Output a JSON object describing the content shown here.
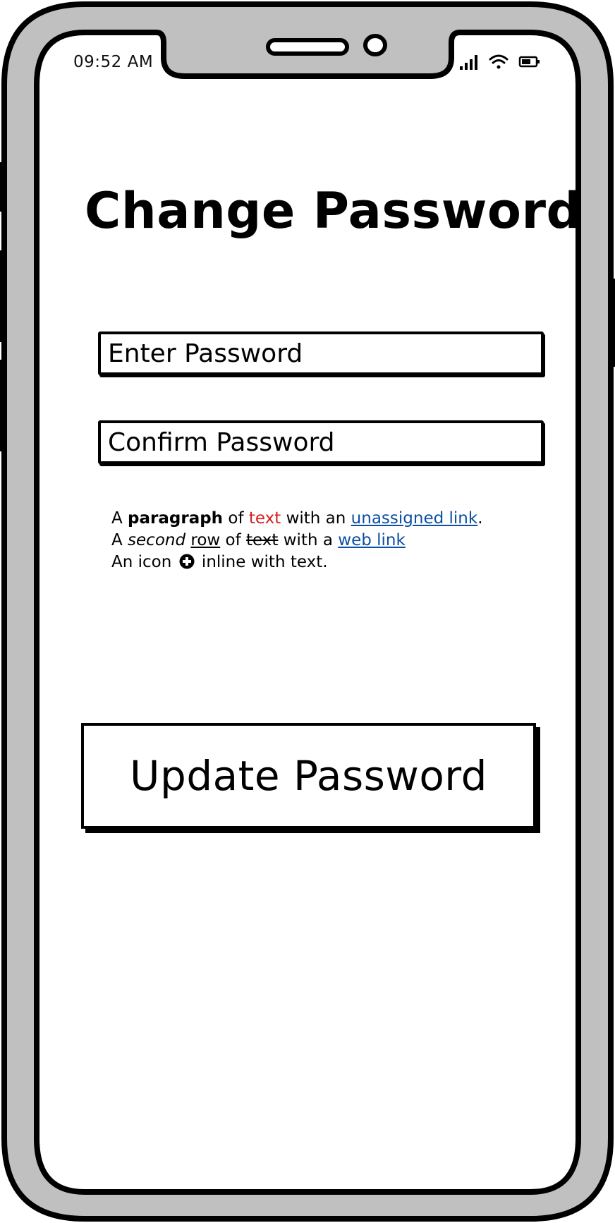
{
  "status_bar": {
    "time": "09:52 AM",
    "icons": [
      "signal-icon",
      "wifi-icon",
      "battery-icon"
    ]
  },
  "page": {
    "title": "Change Password"
  },
  "form": {
    "password_placeholder": "Enter Password",
    "confirm_placeholder": "Confirm Password"
  },
  "paragraph": {
    "line1": {
      "a": "A ",
      "bold": "paragraph",
      "of": " of ",
      "red": "text",
      "with_an": " with an ",
      "link": "unassigned link",
      "end": "."
    },
    "line2": {
      "a": "A ",
      "italic": "second",
      "space": " ",
      "underlined": "row",
      "of": " of ",
      "strike": "text",
      "with_a": " with a ",
      "link": "web link"
    },
    "line3": {
      "before": "An icon ",
      "icon": "plus-circle-icon",
      "after": " inline with text."
    }
  },
  "actions": {
    "update_label": "Update Password"
  },
  "colors": {
    "frame": "#c0c0c0",
    "text": "#000000",
    "red_text": "#d42020",
    "link": "#0c4fa2"
  }
}
